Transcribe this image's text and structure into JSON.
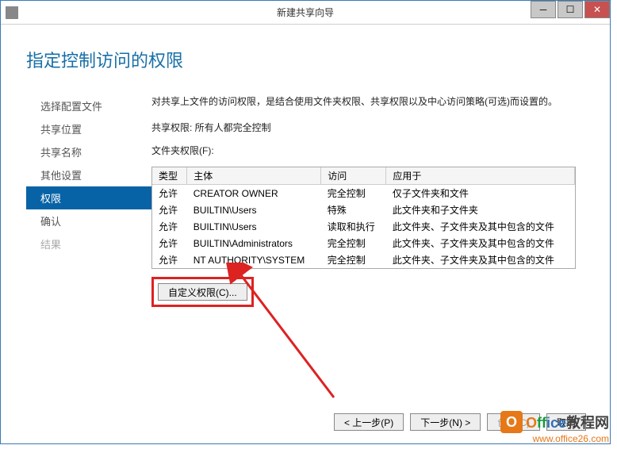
{
  "window": {
    "title": "新建共享向导"
  },
  "heading": "指定控制访问的权限",
  "sidebar": {
    "items": [
      {
        "label": "选择配置文件"
      },
      {
        "label": "共享位置"
      },
      {
        "label": "共享名称"
      },
      {
        "label": "其他设置"
      },
      {
        "label": "权限",
        "active": true
      },
      {
        "label": "确认"
      },
      {
        "label": "结果",
        "disabled": true
      }
    ]
  },
  "main": {
    "description": "对共享上文件的访问权限，是结合使用文件夹权限、共享权限以及中心访问策略(可选)而设置的。",
    "share_perm_line": "共享权限: 所有人都完全控制",
    "folder_perm_label": "文件夹权限(F):",
    "columns": [
      "类型",
      "主体",
      "访问",
      "应用于"
    ],
    "rows": [
      [
        "允许",
        "CREATOR OWNER",
        "完全控制",
        "仅子文件夹和文件"
      ],
      [
        "允许",
        "BUILTIN\\Users",
        "特殊",
        "此文件夹和子文件夹"
      ],
      [
        "允许",
        "BUILTIN\\Users",
        "读取和执行",
        "此文件夹、子文件夹及其中包含的文件"
      ],
      [
        "允许",
        "BUILTIN\\Administrators",
        "完全控制",
        "此文件夹、子文件夹及其中包含的文件"
      ],
      [
        "允许",
        "NT AUTHORITY\\SYSTEM",
        "完全控制",
        "此文件夹、子文件夹及其中包含的文件"
      ]
    ],
    "custom_button": "自定义权限(C)..."
  },
  "footer": {
    "prev": "< 上一步(P)",
    "next": "下一步(N) >",
    "create": "创建(C)",
    "cancel": "取消"
  },
  "watermark": {
    "brand": "Office教程网",
    "url": "www.office26.com"
  }
}
